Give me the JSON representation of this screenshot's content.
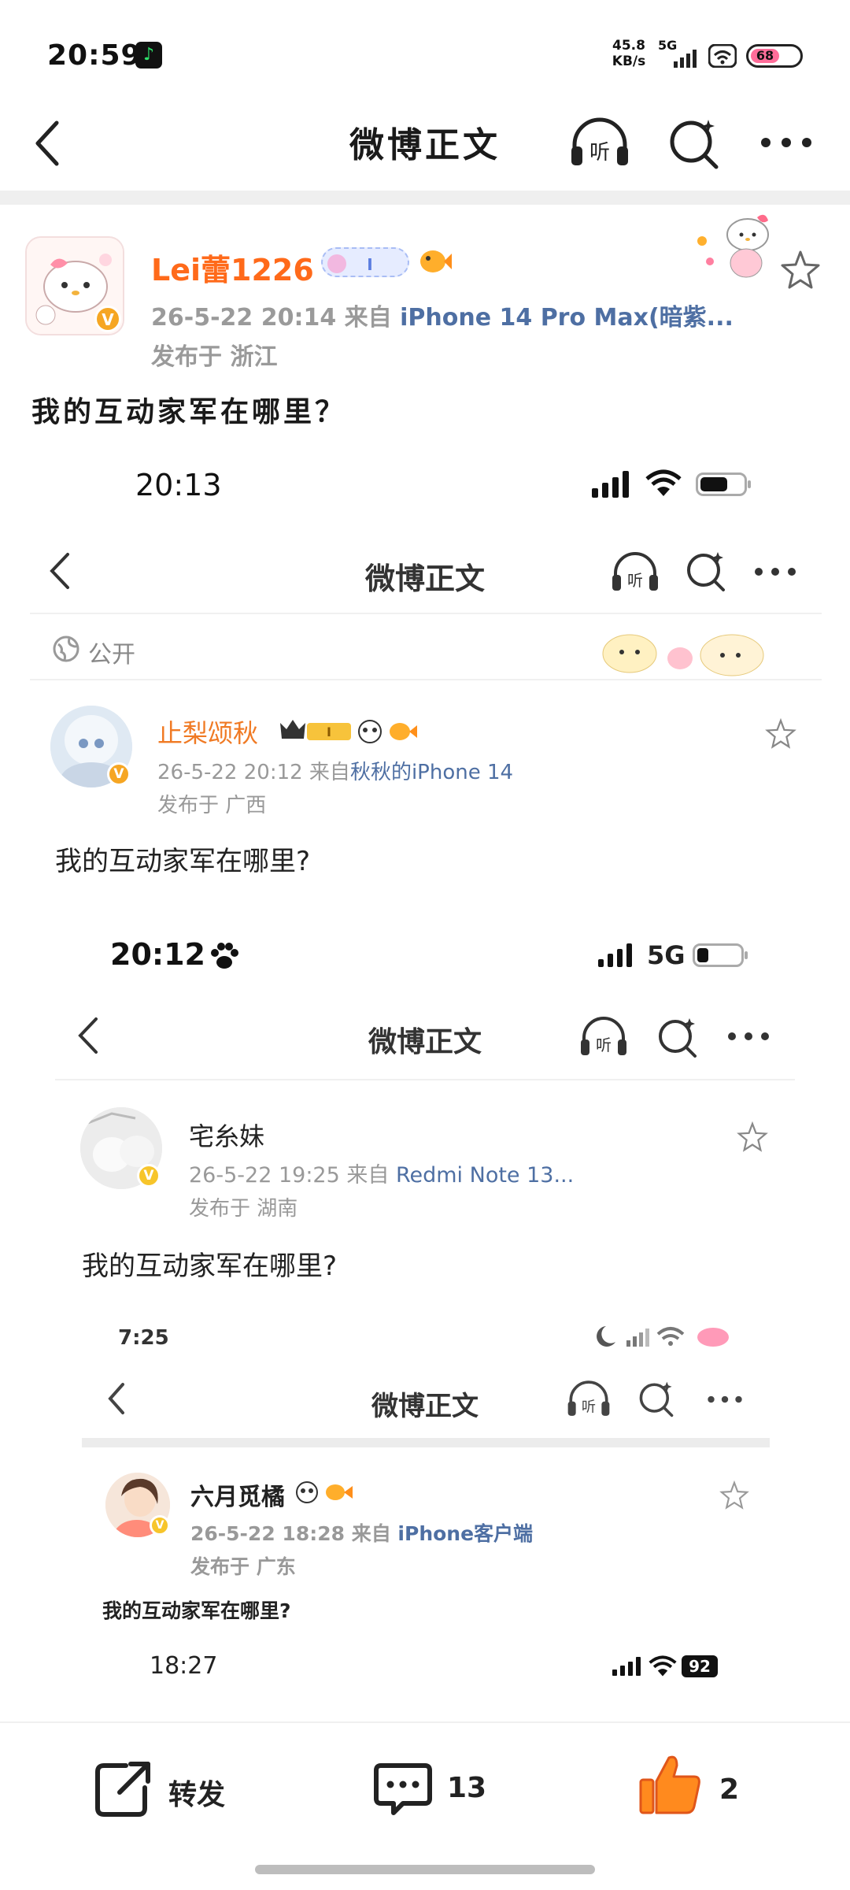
{
  "status_bar": {
    "time": "20:59",
    "net_speed_value": "45.8",
    "net_speed_unit": "KB/s",
    "network": "5G",
    "battery": "68"
  },
  "nav": {
    "title": "微博正文"
  },
  "post": {
    "username": "Lei蕾1226",
    "meta_time": "26-5-22  20:14  来自 ",
    "meta_source": "iPhone  14  Pro  Max(暗紫...",
    "location": "发布于  浙江",
    "content": "我的互动家军在哪里？"
  },
  "screenshot_1": {
    "time": "20:13",
    "nav_title": "微博正文",
    "visibility": "公开",
    "username": "止梨颂秋",
    "meta_time": "26-5-22 20:12  来自",
    "meta_source": "秋秋的iPhone 14",
    "location": "发布于 广西",
    "content": "我的互动家军在哪里?"
  },
  "screenshot_2": {
    "time": "20:12",
    "network": "5G",
    "nav_title": "微博正文",
    "username": "宅糸妹",
    "meta_time": "26-5-22 19:25  来自 ",
    "meta_source": "Redmi Note 13...",
    "location": "发布于 湖南",
    "content": "我的互动家军在哪里?"
  },
  "screenshot_3": {
    "time": "7:25",
    "nav_title": "微博正文",
    "username": "六月觅橘",
    "meta_time": "26-5-22 18:28  来自 ",
    "meta_source": "iPhone客户端",
    "location": "发布于 广东",
    "content": "我的互动家军在哪里?"
  },
  "screenshot_4": {
    "time": "18:27",
    "battery": "92"
  },
  "actions": {
    "repost_label": "转发",
    "comment_count": "13",
    "like_count": "2"
  },
  "colors": {
    "accent_orange": "#ff6a1a",
    "link_blue": "#4e6fa3",
    "like_orange": "#ff7a1a",
    "vip_badge": "#f6a623"
  }
}
